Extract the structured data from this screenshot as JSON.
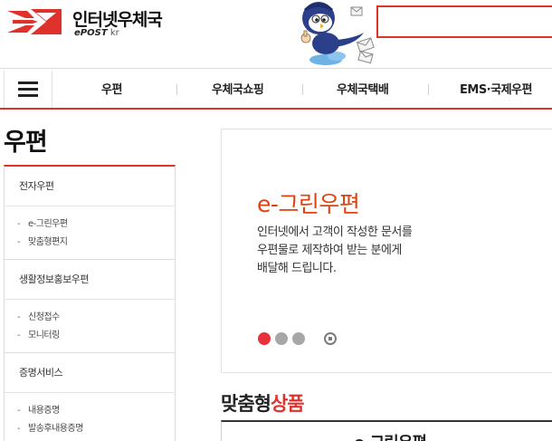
{
  "header": {
    "logo_title": "인터넷우체국",
    "logo_sub_main": "ePOST",
    "logo_sub_suffix": " kr",
    "search_value": "",
    "brand_color": "#e0322c"
  },
  "gnb": {
    "menu_icon": "hamburger-icon",
    "items": [
      "우편",
      "우체국쇼핑",
      "우체국택배",
      "EMS·국제우편"
    ]
  },
  "page_title": "우편",
  "sidebar": {
    "groups": [
      {
        "label": "전자우편",
        "items": [
          "e-그린우편",
          "맞춤형편지"
        ]
      },
      {
        "label": "생활정보홍보우편",
        "items": [
          "신청접수",
          "모니터링"
        ]
      },
      {
        "label": "증명서비스",
        "items": [
          "내용증명",
          "발송후내용증명"
        ]
      }
    ],
    "dash": "-"
  },
  "banner": {
    "title": "e-그린우편",
    "desc_lines": [
      "인터넷에서 고객이 작성한 문서를",
      "우편물로 제작하여 받는 분에게",
      "배달해 드립니다."
    ],
    "slide_count": 3,
    "active_slide": 1,
    "accent_color": "#e0420f"
  },
  "custom_section": {
    "title_dark": "맞춤형",
    "title_red": "상품",
    "product_name": "e-그린우편"
  }
}
